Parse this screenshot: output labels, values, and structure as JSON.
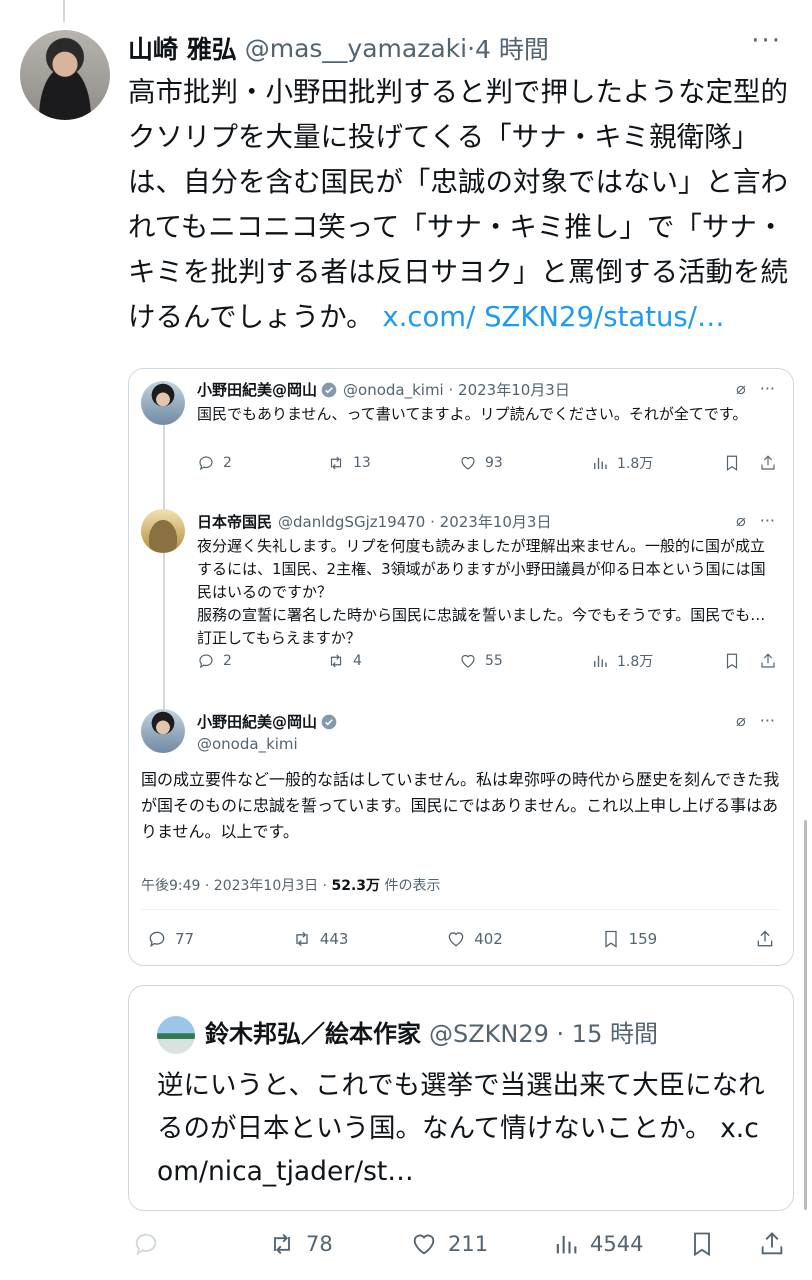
{
  "tweet": {
    "author_name": "山崎 雅弘",
    "handle": "@mas__yamazaki",
    "separator": "·",
    "time": "4 時間",
    "text": "高市批判・小野田批判すると判で押したような定型的クソリプを大量に投げてくる「サナ・キミ親衛隊」は、自分を含む国民が「忠誠の対象ではない」と言われてもニコニコ笑って「サナ・キミ推し」で「サナ・キミを批判する者は反日サヨク」と罵倒する活動を続けるんでしょうか。",
    "link": "x.com/ SZKN29/status/…",
    "more_icon": "more-icon"
  },
  "quote1": {
    "tweet_a": {
      "name": "小野田紀美@岡山",
      "handle_date": "@onoda_kimi · 2023年10月3日",
      "text": "国民でもありません、って書いてますよ。リプ読んでください。それが全てです。",
      "replies": "2",
      "retweets": "13",
      "likes": "93",
      "views": "1.8万"
    },
    "tweet_b": {
      "name": "日本帝国民",
      "handle_date": "@danldgSGjz19470 · 2023年10月3日",
      "text": "夜分遅く失礼します。リプを何度も読みましたが理解出来ません。一般的に国が成立するには、1国民、2主権、3領域がありますが小野田議員が仰る日本という国には国民はいるのですか？\n服務の宣誓に署名した時から国民に忠誠を誓いました。今でもそうです。国民でも…訂正してもらえますか？",
      "replies": "2",
      "retweets": "4",
      "likes": "55",
      "views": "1.8万"
    },
    "tweet_c": {
      "name": "小野田紀美@岡山",
      "handle": "@onoda_kimi",
      "text": "国の成立要件など一般的な話はしていません。私は卑弥呼の時代から歴史を刻んできた我が国そのものに忠誠を誓っています。国民にではありません。これ以上申し上げる事はありません。以上です。",
      "meta_time": "午後9:49 · 2023年10月3日 · ",
      "meta_views": "52.3万",
      "meta_suffix": " 件の表示",
      "replies": "77",
      "retweets": "443",
      "likes": "402",
      "bookmarks": "159"
    }
  },
  "quote2": {
    "name": "鈴木邦弘／絵本作家",
    "handle_time": "@SZKN29 · 15 時間",
    "text": "逆にいうと、これでも選挙で当選出来て大臣になれるのが日本という国。なんて情けないことか。",
    "link": "x.com/nica_tjader/st…"
  },
  "actions": {
    "retweets": "78",
    "likes": "211",
    "views": "4544"
  },
  "colors": {
    "link": "#1d9bf0",
    "muted": "#536471",
    "border": "#cfd9de"
  }
}
